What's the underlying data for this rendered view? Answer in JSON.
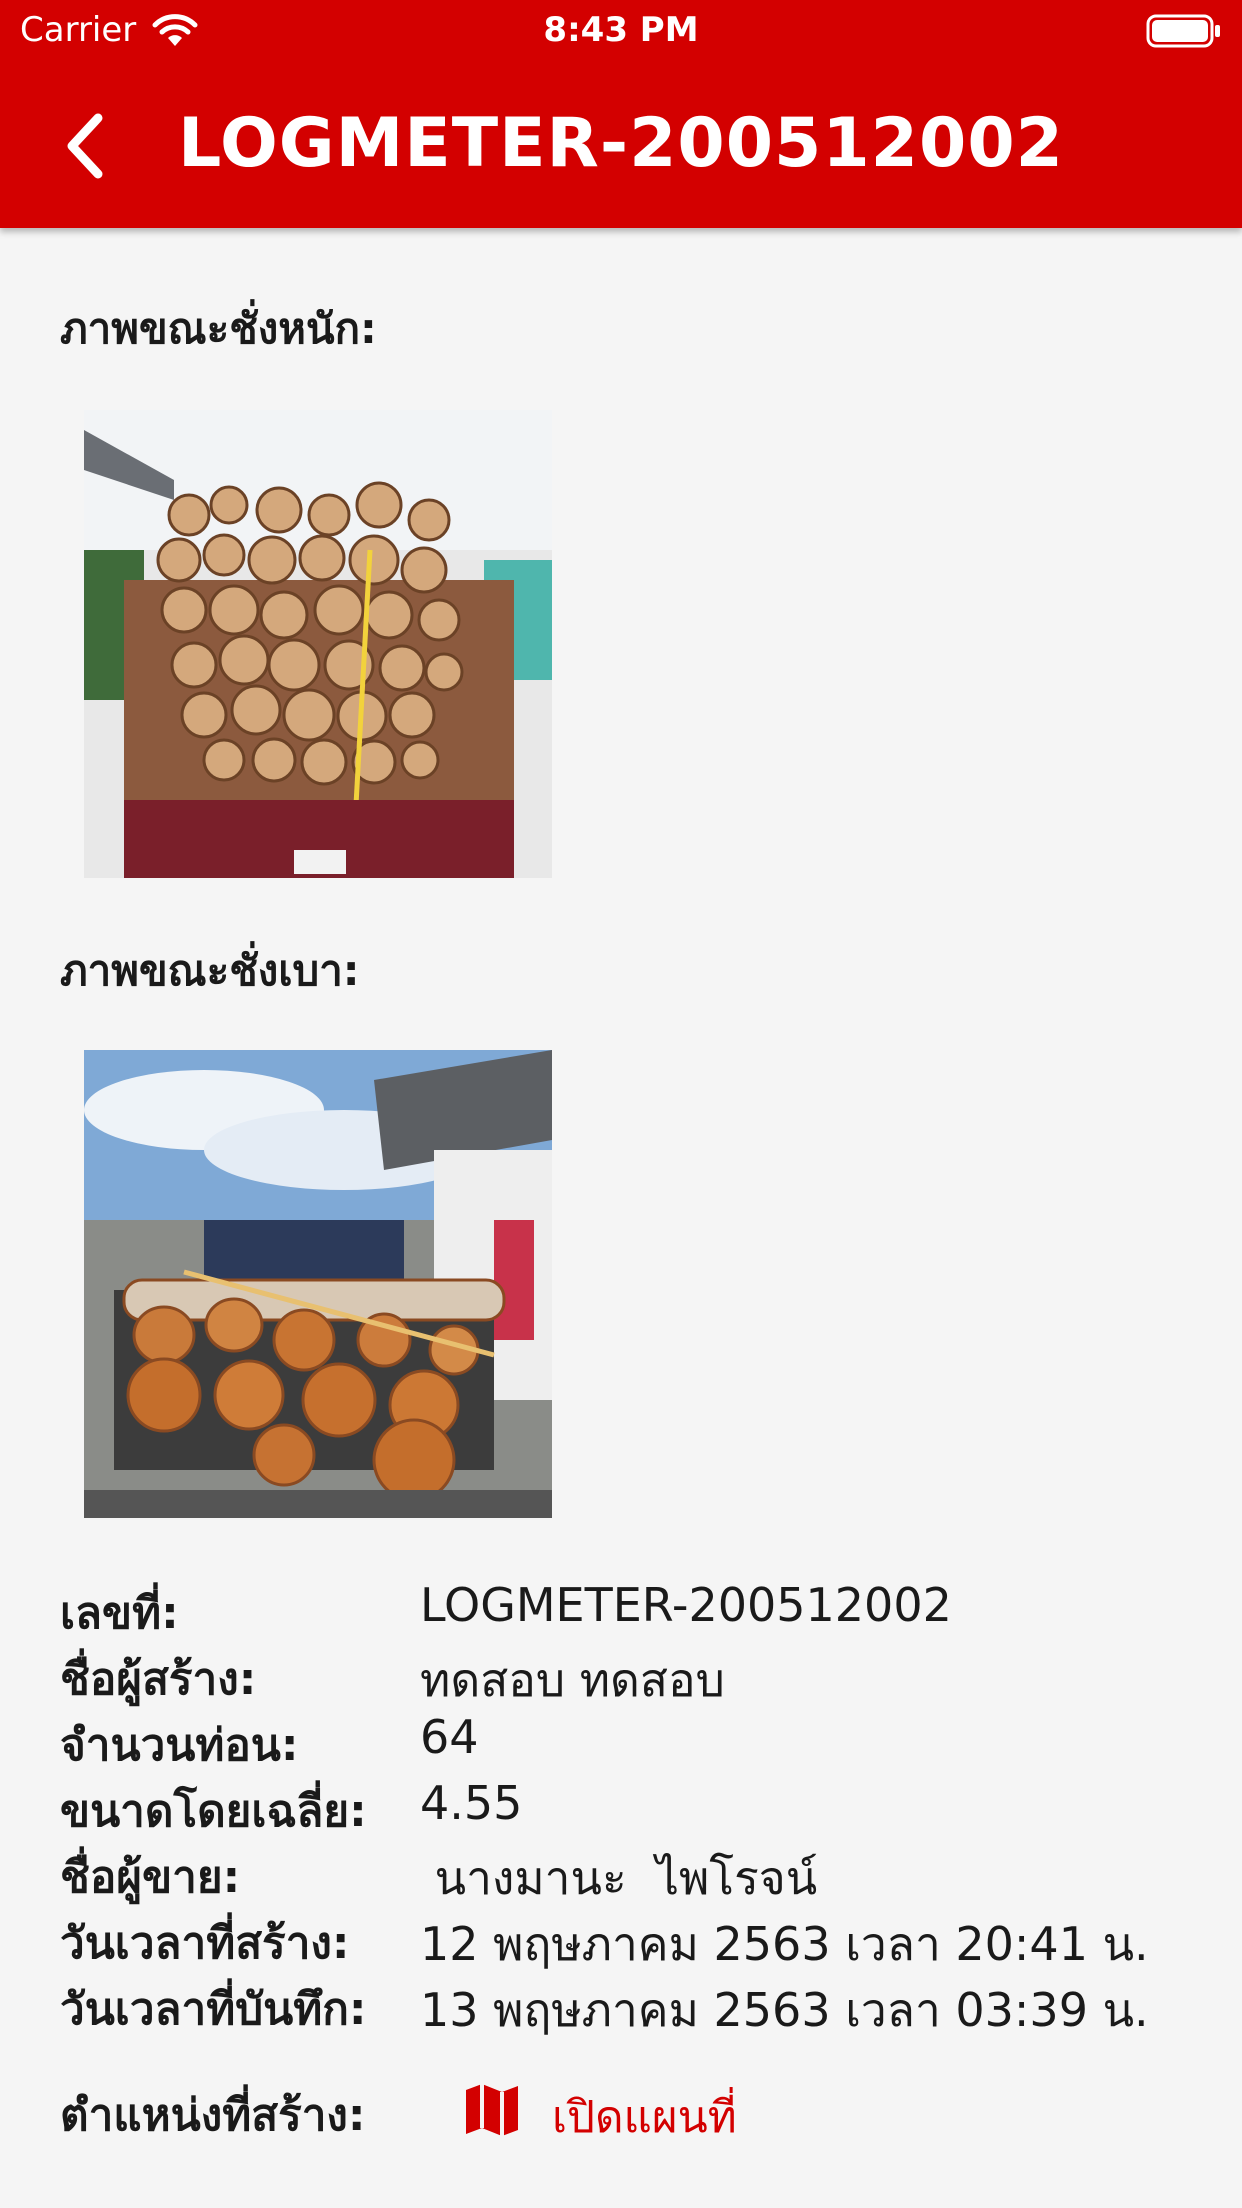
{
  "status_bar": {
    "carrier": "Carrier",
    "time": "8:43 PM"
  },
  "header": {
    "title": "LOGMETER-200512002",
    "back_icon": "chevron-left-icon",
    "bg_color": "#d30000"
  },
  "photos": {
    "heavy_label": "ภาพขณะชั่งหนัก:",
    "light_label": "ภาพขณะชั่งเบา:"
  },
  "details": [
    {
      "label": "เลขที่:",
      "value": "LOGMETER-200512002"
    },
    {
      "label": "ชื่อผู้สร้าง:",
      "value": "ทดสอบ ทดสอบ"
    },
    {
      "label": "จำนวนท่อน:",
      "value": "64"
    },
    {
      "label": "ขนาดโดยเฉลี่ย:",
      "value": "4.55"
    },
    {
      "label": "ชื่อผู้ขาย:",
      "value": " นางมานะ  ไพโรจน์"
    },
    {
      "label": "วันเวลาที่สร้าง:",
      "value": "12 พฤษภาคม 2563 เวลา 20:41 น."
    },
    {
      "label": "วันเวลาที่บันทึก:",
      "value": "13 พฤษภาคม 2563 เวลา 03:39 น."
    }
  ],
  "location": {
    "label": "ตำแหน่งที่สร้าง:",
    "link_label": "เปิดแผนที่",
    "icon": "map-icon",
    "accent_color": "#d30000"
  }
}
